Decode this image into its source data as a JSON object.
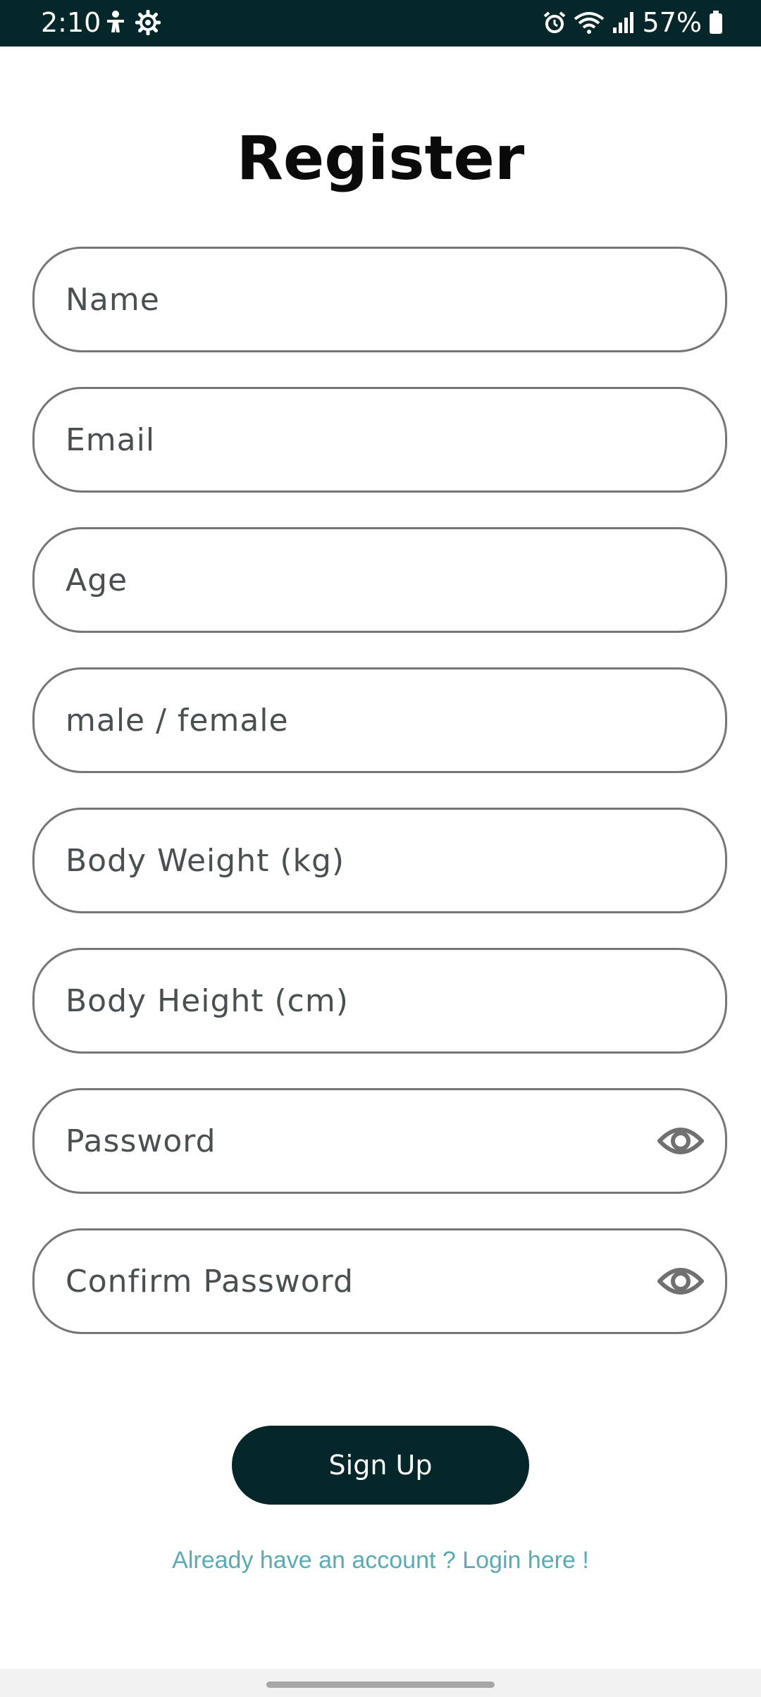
{
  "status_bar": {
    "time": "2:10",
    "battery_percent": "57%",
    "left_icons": [
      "accessibility-icon",
      "settings-gear-icon"
    ],
    "right_icons": [
      "alarm-icon",
      "wifi-icon",
      "signal-icon",
      "battery-icon"
    ],
    "background_color": "#05272a"
  },
  "page": {
    "title": "Register"
  },
  "form": {
    "fields": [
      {
        "placeholder": "Name",
        "value": ""
      },
      {
        "placeholder": "Email",
        "value": ""
      },
      {
        "placeholder": "Age",
        "value": ""
      },
      {
        "placeholder": "male / female",
        "value": ""
      },
      {
        "placeholder": "Body Weight (kg)",
        "value": ""
      },
      {
        "placeholder": "Body Height (cm)",
        "value": ""
      },
      {
        "placeholder": "Password",
        "value": "",
        "icon": "eye-icon"
      },
      {
        "placeholder": "Confirm Password",
        "value": "",
        "icon": "eye-icon"
      }
    ],
    "submit_label": "Sign Up",
    "login_link": "Already have an account ? Login here !"
  },
  "colors": {
    "primary": "#05272a",
    "link": "#5aaab3",
    "field_border": "#767676"
  }
}
